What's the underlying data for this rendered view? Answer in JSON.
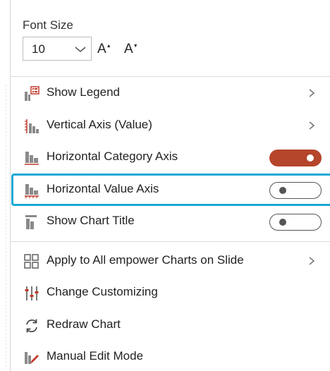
{
  "font_size": {
    "label": "Font Size",
    "value": "10",
    "increase_label": "A",
    "decrease_label": "A"
  },
  "menu": {
    "show_legend": "Show Legend",
    "vertical_axis": "Vertical Axis (Value)",
    "horizontal_category_axis": "Horizontal Category Axis",
    "horizontal_value_axis": "Horizontal Value Axis",
    "show_chart_title": "Show Chart Title",
    "apply_all": "Apply to All empower Charts on Slide",
    "change_customizing": "Change Customizing",
    "redraw_chart": "Redraw Chart",
    "manual_edit": "Manual Edit Mode"
  },
  "toggles": {
    "horizontal_category_axis": true,
    "horizontal_value_axis": false,
    "show_chart_title": false
  },
  "colors": {
    "accent": "#b5452b",
    "highlight": "#19a9d6",
    "icon_red": "#c0392b",
    "icon_gray": "#8a8a8a"
  }
}
